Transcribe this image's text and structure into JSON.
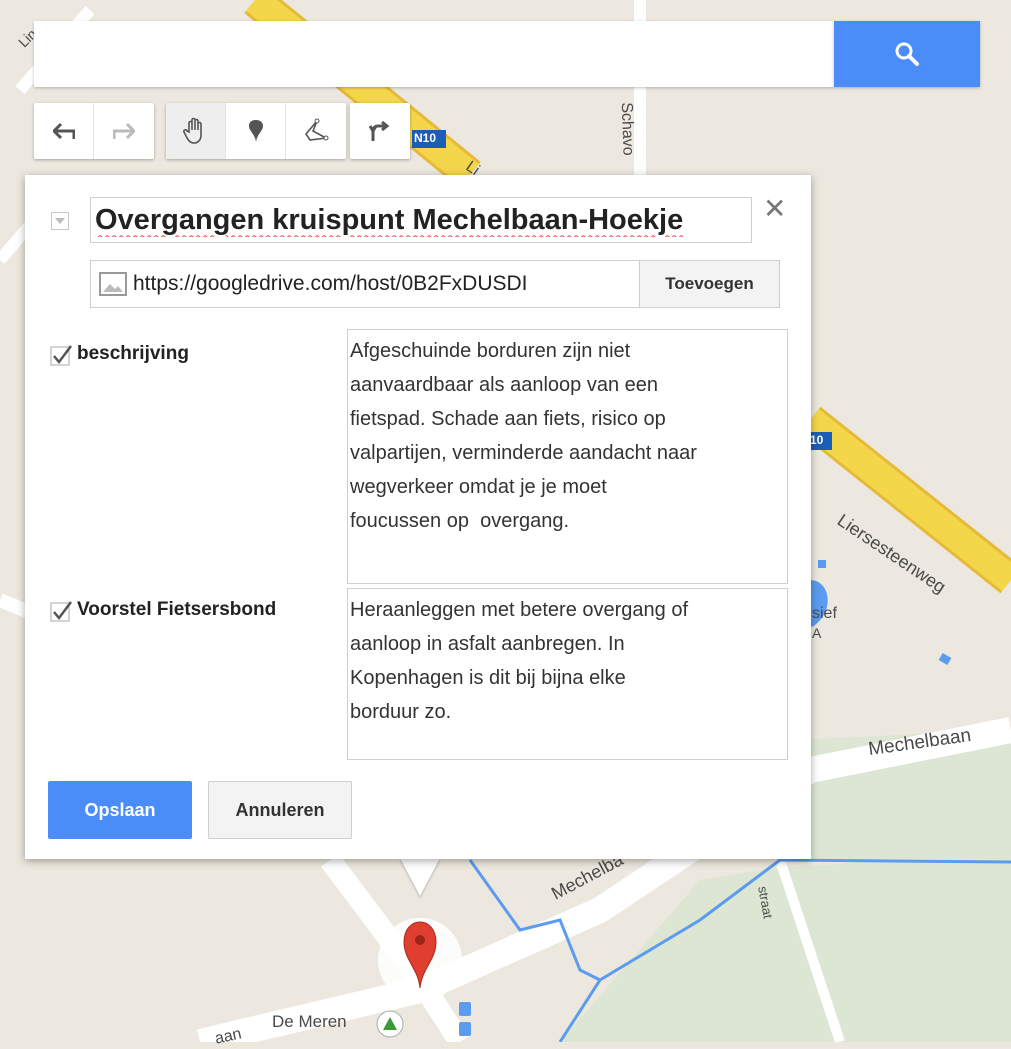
{
  "map": {
    "labels": {
      "road_top_left": "Lin",
      "street_schavo": "Schavo",
      "road_badge_1": "N10",
      "road_badge_2": "10",
      "liersesteenweg": "Liersesteenweg",
      "mechelbaan_right": "Mechelbaan",
      "mechelbaan_bottom": "Mechelba",
      "poi_sief": "sief",
      "poi_a": "A",
      "straat": "straat",
      "de_meren": "De Meren",
      "aan_bottom": "aan",
      "lin_partial": "Li"
    },
    "colors": {
      "background": "#ece8df",
      "road_yellow": "#f4d64a",
      "road_border": "#e6b937",
      "water": "#5b9bf0",
      "green": "#dde6d3"
    }
  },
  "search": {
    "value": "",
    "placeholder": "",
    "icon": "search-icon"
  },
  "toolbar": {
    "undo": "undo-icon",
    "redo": "redo-icon",
    "pan": "hand-icon",
    "marker": "marker-icon",
    "line": "draw-line-icon",
    "directions": "directions-icon"
  },
  "dialog": {
    "title": "Overgangen kruispunt Mechelbaan-Hoekje",
    "image_url": "https://googledrive.com/host/0B2FxDUSDI",
    "add_label": "Toevoegen",
    "fields": [
      {
        "label": "beschrijving",
        "checked": true,
        "value": "Afgeschuinde borduren zijn niet\naanvaardbaar als aanloop van een\nfietspad. Schade aan fiets, risico op\nvalpartijen, verminderde aandacht naar\nwegverkeer omdat je je moet\nfoucussen op  overgang."
      },
      {
        "label": "Voorstel Fietsersbond",
        "checked": true,
        "value": "Heraanleggen met betere overgang of\naanloop in asfalt aanbregen. In\nKopenhagen is dit bij bijna elke\nborduur zo."
      }
    ],
    "save_label": "Opslaan",
    "cancel_label": "Annuleren",
    "close_icon": "close-icon",
    "accent": "#4b8df8"
  }
}
